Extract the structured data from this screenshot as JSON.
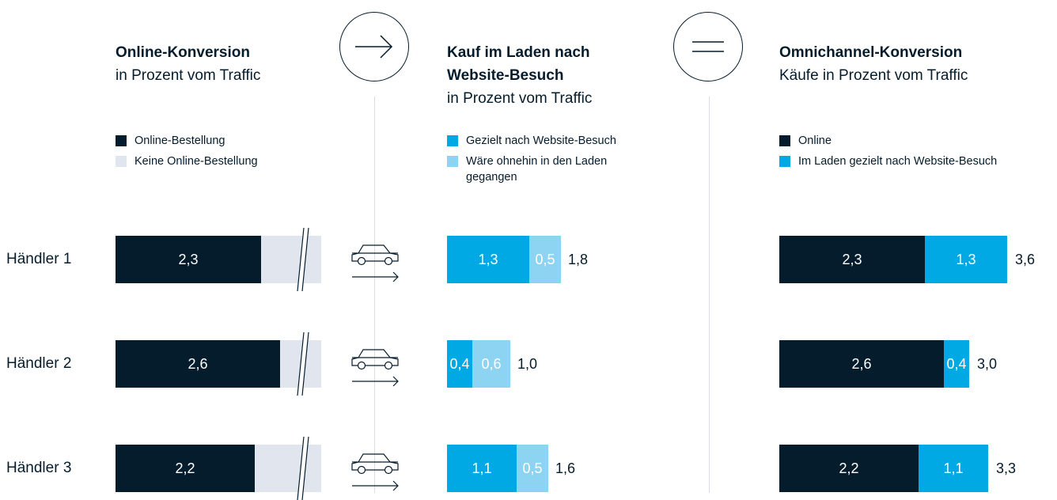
{
  "colors": {
    "navy": "#051c2c",
    "lightgray": "#e1e5ee",
    "cyan": "#00a9e4",
    "lightcyan": "#8dd3f2",
    "white": "#ffffff"
  },
  "icons": {
    "arrow": "arrow-right-circle-icon",
    "equals": "equals-circle-icon",
    "car": "car-arrow-icon",
    "break": "axis-break-icon"
  },
  "rows": [
    "Händler 1",
    "Händler 2",
    "Händler 3"
  ],
  "panels": {
    "online": {
      "title": "Online-Konversion",
      "subtitle": "in Prozent vom Traffic",
      "legend": [
        {
          "label": "Online-Bestellung",
          "color": "#051c2c"
        },
        {
          "label": "Keine Online-Bestellung",
          "color": "#e1e5ee"
        }
      ]
    },
    "store": {
      "title_line1": "Kauf im Laden nach",
      "title_line2": "Website-Besuch",
      "subtitle": "in Prozent vom Traffic",
      "legend": [
        {
          "label": "Gezielt nach Website-Besuch",
          "color": "#00a9e4"
        },
        {
          "label": "Wäre ohnehin in den Laden",
          "label2": "gegangen",
          "color": "#8dd3f2"
        }
      ]
    },
    "omni": {
      "title": "Omnichannel-Konversion",
      "subtitle": "Käufe in Prozent vom Traffic",
      "legend": [
        {
          "label": "Online",
          "color": "#051c2c"
        },
        {
          "label": "Im Laden gezielt nach Website-Besuch",
          "color": "#00a9e4"
        }
      ]
    }
  },
  "chart_data": [
    {
      "type": "bar",
      "orientation": "horizontal",
      "stacked": true,
      "title": "Online-Konversion",
      "subtitle": "in Prozent vom Traffic",
      "categories": [
        "Händler 1",
        "Händler 2",
        "Händler 3"
      ],
      "series": [
        {
          "name": "Online-Bestellung",
          "values": [
            2.3,
            2.6,
            2.2
          ],
          "labels": [
            "2,3",
            "2,6",
            "2,2"
          ],
          "color": "#051c2c"
        },
        {
          "name": "Keine Online-Bestellung",
          "values": [
            null,
            null,
            null
          ],
          "note_visible": "axis break",
          "color": "#e1e5ee"
        }
      ]
    },
    {
      "type": "bar",
      "orientation": "horizontal",
      "stacked": true,
      "title": "Kauf im Laden nach Website-Besuch",
      "subtitle": "in Prozent vom Traffic",
      "categories": [
        "Händler 1",
        "Händler 2",
        "Händler 3"
      ],
      "series": [
        {
          "name": "Gezielt nach Website-Besuch",
          "values": [
            1.3,
            0.4,
            1.1
          ],
          "labels": [
            "1,3",
            "0,4",
            "1,1"
          ],
          "color": "#00a9e4"
        },
        {
          "name": "Wäre ohnehin in den Laden gegangen",
          "values": [
            0.5,
            0.6,
            0.5
          ],
          "labels": [
            "0,5",
            "0,6",
            "0,5"
          ],
          "color": "#8dd3f2"
        }
      ],
      "totals": [
        1.8,
        1.0,
        1.6
      ],
      "total_labels": [
        "1,8",
        "1,0",
        "1,6"
      ]
    },
    {
      "type": "bar",
      "orientation": "horizontal",
      "stacked": true,
      "title": "Omnichannel-Konversion",
      "subtitle": "Käufe in Prozent vom Traffic",
      "categories": [
        "Händler 1",
        "Händler 2",
        "Händler 3"
      ],
      "series": [
        {
          "name": "Online",
          "values": [
            2.3,
            2.6,
            2.2
          ],
          "labels": [
            "2,3",
            "2,6",
            "2,2"
          ],
          "color": "#051c2c"
        },
        {
          "name": "Im Laden gezielt nach Website-Besuch",
          "values": [
            1.3,
            0.4,
            1.1
          ],
          "labels": [
            "1,3",
            "0,4",
            "1,1"
          ],
          "color": "#00a9e4"
        }
      ],
      "totals": [
        3.6,
        3.0,
        3.3
      ],
      "total_labels": [
        "3,6",
        "3,0",
        "3,3"
      ]
    }
  ]
}
